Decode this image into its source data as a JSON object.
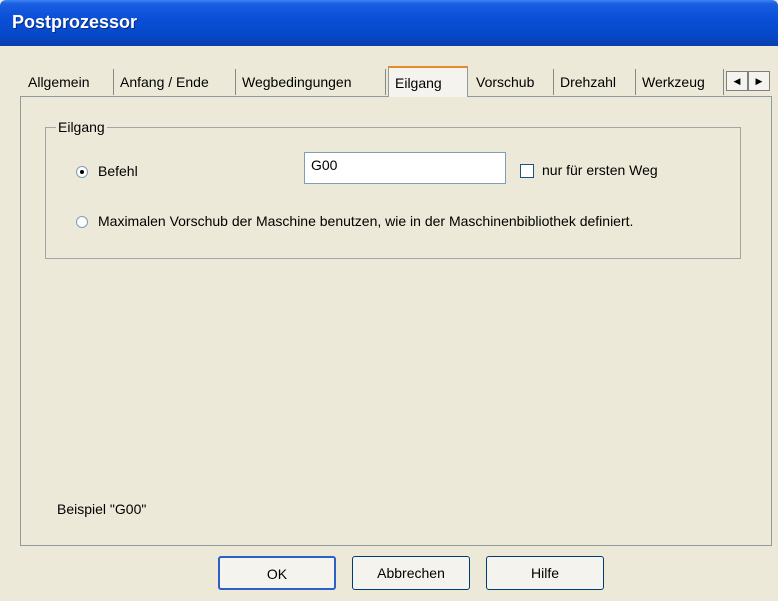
{
  "window": {
    "title": "Postprozessor"
  },
  "tabs": [
    "Allgemein",
    "Anfang / Ende",
    "Wegbedingungen",
    "Eilgang",
    "Vorschub",
    "Drehzahl",
    "Werkzeug"
  ],
  "active_tab": "Eilgang",
  "group": {
    "title": "Eilgang",
    "option_command": "Befehl",
    "command_value": "G00",
    "checkbox_label": "nur für ersten Weg",
    "option_max_feed": "Maximalen Vorschub der Maschine benutzen, wie in der Maschinenbibliothek definiert."
  },
  "example": "Beispiel  \"G00\"",
  "buttons": {
    "ok": "OK",
    "cancel": "Abbrechen",
    "help": "Hilfe"
  },
  "icons": {
    "scroll_left": "arrow-left-icon",
    "scroll_right": "arrow-right-icon"
  }
}
